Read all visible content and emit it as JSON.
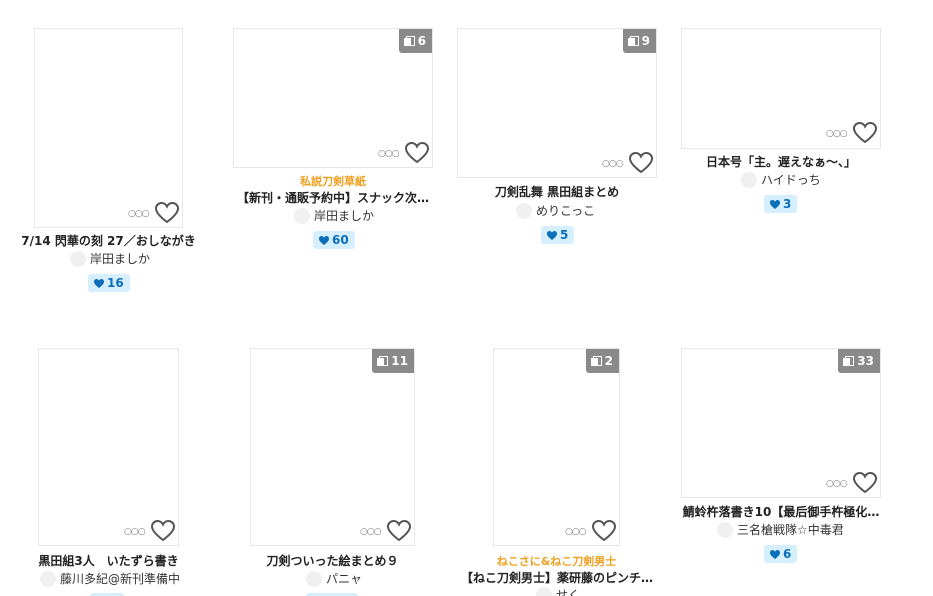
{
  "colors": {
    "series_accent": "#f0a020",
    "like_badge_bg": "#d6efff",
    "like_badge_text": "#0a6fb8",
    "page_badge_bg": "#8a8a8a"
  },
  "icons": {
    "page_count": "pages-icon",
    "more": "more-icon",
    "like": "heart-outline-icon",
    "like_count": "heart-filled-icon"
  },
  "more_glyph": "○○○",
  "works": [
    {
      "title": "7/14 閃華の刻 27／おしながき",
      "series": "",
      "author": "岸田ましか",
      "pages": "",
      "likes": "16"
    },
    {
      "title": "【新刊・通販予約中】スナック次…",
      "series": "私説刀剣草紙",
      "author": "岸田ましか",
      "pages": "6",
      "likes": "60"
    },
    {
      "title": "刀剣乱舞 黒田組まとめ",
      "series": "",
      "author": "めりこっこ",
      "pages": "9",
      "likes": "5"
    },
    {
      "title": "日本号「主。遅えなぁ〜、」",
      "series": "",
      "author": "ハイドっち",
      "pages": "",
      "likes": "3"
    },
    {
      "title": "黒田組3人　いたずら書き",
      "series": "",
      "author": "藤川多紀@新刊準備中",
      "pages": "",
      "likes": ""
    },
    {
      "title": "刀剣ついった絵まとめ９",
      "series": "",
      "author": "パニャ",
      "pages": "11",
      "likes": ""
    },
    {
      "title": "【ねこ刀剣男士】薬研藤のピンチ…",
      "series": "ねこさに&ねこ刀剣男士",
      "author": "せく",
      "pages": "2",
      "likes": ""
    },
    {
      "title": "鯖蛉杵落書き10【最后御手杵極化…",
      "series": "",
      "author": "三名槍戦隊☆中毒君",
      "pages": "33",
      "likes": "6"
    }
  ]
}
